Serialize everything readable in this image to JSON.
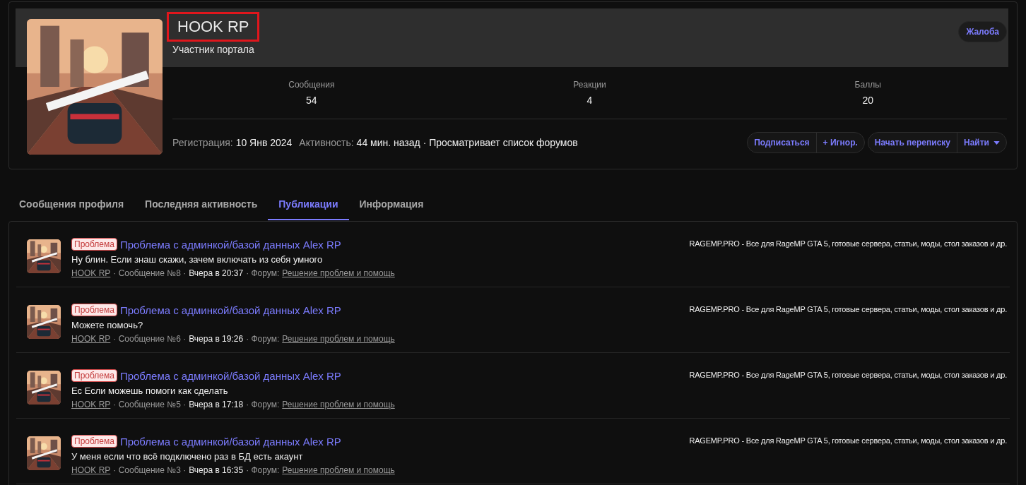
{
  "profile": {
    "name": "HOOK RP",
    "name_highlighted": true,
    "user_title": "Участник портала",
    "report_button": "Жалоба",
    "stats": [
      {
        "label": "Сообщения",
        "value": "54"
      },
      {
        "label": "Реакции",
        "value": "4"
      },
      {
        "label": "Баллы",
        "value": "20"
      }
    ],
    "registration_label": "Регистрация:",
    "registration_value": "10 Янв 2024",
    "activity_label": "Активность:",
    "activity_value": "44 мин. назад · Просматривает список форумов",
    "button_groups": [
      [
        {
          "label": "Подписаться",
          "dropdown": false
        },
        {
          "label": "+ Игнор.",
          "dropdown": false
        }
      ],
      [
        {
          "label": "Начать переписку",
          "dropdown": false
        },
        {
          "label": "Найти",
          "dropdown": true
        }
      ]
    ]
  },
  "tabs": [
    {
      "label": "Сообщения профиля",
      "selected": false
    },
    {
      "label": "Последняя активность",
      "selected": false
    },
    {
      "label": "Публикации",
      "selected": true
    },
    {
      "label": "Информация",
      "selected": false
    }
  ],
  "posts": [
    {
      "prefix": "Проблема",
      "title": "Проблема с админкой/базой данных Alex RP",
      "snippet": "Ну блин. Если знаш скажи, зачем включать из себя умного",
      "author": "HOOK RP",
      "post_number": "· Сообщение №8 ·",
      "time": "Вчера в 20:37",
      "forum_label": "· Форум:",
      "forum": "Решение проблем и помощь",
      "site_note": "RAGEMP.PRO - Все для RageMP GTA 5, готовые сервера, статьи, моды, стол заказов и др."
    },
    {
      "prefix": "Проблема",
      "title": "Проблема с админкой/базой данных Alex RP",
      "snippet": "Можете помочь?",
      "author": "HOOK RP",
      "post_number": "· Сообщение №6 ·",
      "time": "Вчера в 19:26",
      "forum_label": "· Форум:",
      "forum": "Решение проблем и помощь",
      "site_note": "RAGEMP.PRO - Все для RageMP GTA 5, готовые сервера, статьи, моды, стол заказов и др."
    },
    {
      "prefix": "Проблема",
      "title": "Проблема с админкой/базой данных Alex RP",
      "snippet": "Ес Если можешь помоги как сделать",
      "author": "HOOK RP",
      "post_number": "· Сообщение №5 ·",
      "time": "Вчера в 17:18",
      "forum_label": "· Форум:",
      "forum": "Решение проблем и помощь",
      "site_note": "RAGEMP.PRO - Все для RageMP GTA 5, готовые сервера, статьи, моды, стол заказов и др."
    },
    {
      "prefix": "Проблема",
      "title": "Проблема с админкой/базой данных Alex RP",
      "snippet": "У меня если что всё подключено раз в БД есть акаунт",
      "author": "HOOK RP",
      "post_number": "· Сообщение №3 ·",
      "time": "Вчера в 16:35",
      "forum_label": "· Форум:",
      "forum": "Решение проблем и помощь",
      "site_note": "RAGEMP.PRO - Все для RageMP GTA 5, готовые сервера, статьи, моды, стол заказов и др."
    }
  ]
}
